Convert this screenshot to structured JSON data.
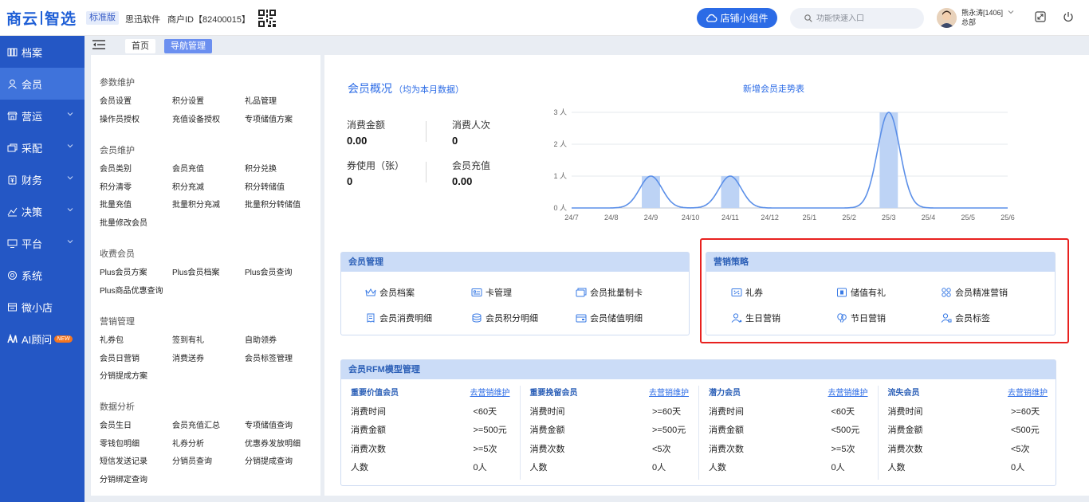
{
  "brand": {
    "name_left": "商云",
    "name_right": "智选",
    "edition": "标准版",
    "company": "思迅软件",
    "merchant": "商户ID【82400015】"
  },
  "header": {
    "shop_widget": "店铺小组件",
    "search_placeholder": "功能快速入口",
    "user_name": "熊永涛[1406]",
    "user_org": "总部"
  },
  "sidebar": {
    "items": [
      {
        "label": "档案",
        "icon": "archive-icon"
      },
      {
        "label": "会员",
        "icon": "user-icon",
        "active": true
      },
      {
        "label": "营运",
        "icon": "store-icon"
      },
      {
        "label": "采配",
        "icon": "purchase-icon"
      },
      {
        "label": "财务",
        "icon": "finance-icon"
      },
      {
        "label": "决策",
        "icon": "decision-icon"
      },
      {
        "label": "平台",
        "icon": "platform-icon"
      },
      {
        "label": "系统",
        "icon": "system-icon"
      },
      {
        "label": "微小店",
        "icon": "shop-icon"
      },
      {
        "label": "AI顾问",
        "icon": "ai-icon",
        "badge": "NEW"
      }
    ]
  },
  "tabs": {
    "home": "首页",
    "current": "导航管理"
  },
  "functions": [
    {
      "title": "参数维护",
      "items": [
        "会员设置",
        "积分设置",
        "礼品管理",
        "操作员授权",
        "充值设备授权",
        "专项储值方案"
      ]
    },
    {
      "title": "会员维护",
      "items": [
        "会员类别",
        "会员充值",
        "积分兑换",
        "积分清零",
        "积分充减",
        "积分转储值",
        "批量充值",
        "批量积分充减",
        "批量积分转储值",
        "批量修改会员"
      ]
    },
    {
      "title": "收费会员",
      "items": [
        "Plus会员方案",
        "Plus会员档案",
        "Plus会员查询",
        "Plus商品优惠查询"
      ]
    },
    {
      "title": "营销管理",
      "items": [
        "礼券包",
        "签到有礼",
        "自助领券",
        "会员日营销",
        "消费送券",
        "会员标签管理",
        "分销提成方案"
      ]
    },
    {
      "title": "数据分析",
      "items": [
        "会员生日",
        "会员充值汇总",
        "专项储值查询",
        "零钱包明细",
        "礼券分析",
        "优惠券发放明细",
        "短信发送记录",
        "分销员查询",
        "分销提成查询",
        "分销绑定查询"
      ]
    }
  ],
  "overview": {
    "title": "会员概况",
    "subtitle": "（均为本月数据）",
    "stats": [
      {
        "label": "消费金额",
        "value": "0.00"
      },
      {
        "label": "消费人次",
        "value": "0"
      },
      {
        "label": "券使用（张）",
        "value": "0"
      },
      {
        "label": "会员充值",
        "value": "0.00"
      }
    ]
  },
  "chart_data": {
    "type": "line",
    "title": "新增会员走势表",
    "categories": [
      "24/7",
      "24/8",
      "24/9",
      "24/10",
      "24/11",
      "24/12",
      "25/1",
      "25/2",
      "25/3",
      "25/4",
      "25/5",
      "25/6"
    ],
    "values": [
      0,
      0,
      1,
      0,
      1,
      0,
      0,
      0,
      3,
      0,
      0,
      0
    ],
    "y_ticks": [
      "0 人",
      "1 人",
      "2 人",
      "3 人"
    ],
    "ylim": [
      0,
      3
    ],
    "grid": true,
    "line_color": "#5b8fe8",
    "bar_color": "#bdd3f5"
  },
  "member_mgmt": {
    "title": "会员管理",
    "items": [
      {
        "label": "会员档案",
        "icon": "crown-icon"
      },
      {
        "label": "卡管理",
        "icon": "card-icon"
      },
      {
        "label": "会员批量制卡",
        "icon": "batch-card-icon"
      },
      {
        "label": "会员消费明细",
        "icon": "receipt-icon"
      },
      {
        "label": "会员积分明细",
        "icon": "coins-icon"
      },
      {
        "label": "会员储值明细",
        "icon": "wallet-icon"
      }
    ]
  },
  "marketing": {
    "title": "营销策略",
    "items": [
      {
        "label": "礼券",
        "icon": "coupon-icon"
      },
      {
        "label": "储值有礼",
        "icon": "gift-card-icon"
      },
      {
        "label": "会员精准营销",
        "icon": "grid-icon"
      },
      {
        "label": "生日营销",
        "icon": "birthday-user-icon"
      },
      {
        "label": "节日营销",
        "icon": "balloon-icon"
      },
      {
        "label": "会员标签",
        "icon": "tag-user-icon"
      }
    ]
  },
  "rfm": {
    "title": "会员RFM模型管理",
    "row_labels": [
      "消费时间",
      "消费金额",
      "消费次数",
      "人数"
    ],
    "link_text": "去营销维护",
    "columns": [
      {
        "name": "重要价值会员",
        "values": [
          "<60天",
          ">=500元",
          ">=5次",
          "0人"
        ]
      },
      {
        "name": "重要挽留会员",
        "values": [
          ">=60天",
          ">=500元",
          "<5次",
          "0人"
        ]
      },
      {
        "name": "潜力会员",
        "values": [
          "<60天",
          "<500元",
          ">=5次",
          "0人"
        ]
      },
      {
        "name": "流失会员",
        "values": [
          ">=60天",
          "<500元",
          "<5次",
          "0人"
        ]
      }
    ]
  }
}
